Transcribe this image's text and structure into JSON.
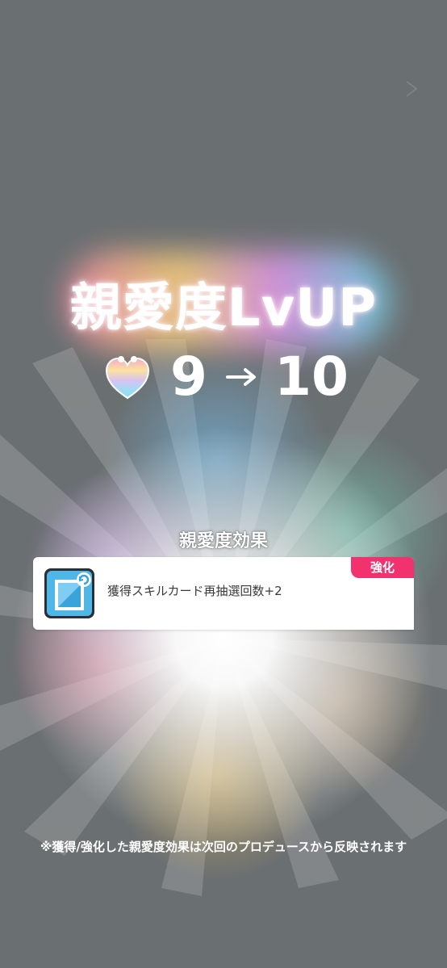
{
  "screen": {
    "title": "親愛度LvUP",
    "skip_icon": "skip-chevron-icon"
  },
  "level": {
    "icon": "rainbow-heart-icon",
    "from": "9",
    "arrow_icon": "arrow-right-icon",
    "to": "10"
  },
  "effects": {
    "header": "親愛度効果",
    "items": [
      {
        "badge": "強化",
        "icon": "skill-card-redraw-icon",
        "text": "獲得スキルカード再抽選回数+2"
      }
    ]
  },
  "footnote": "※獲得/強化した親愛度効果は次回のプロデュースから反映されます",
  "colors": {
    "background": "#6a6f71",
    "badge": "#f2316f",
    "icon_blue": "#4fb6e8"
  }
}
